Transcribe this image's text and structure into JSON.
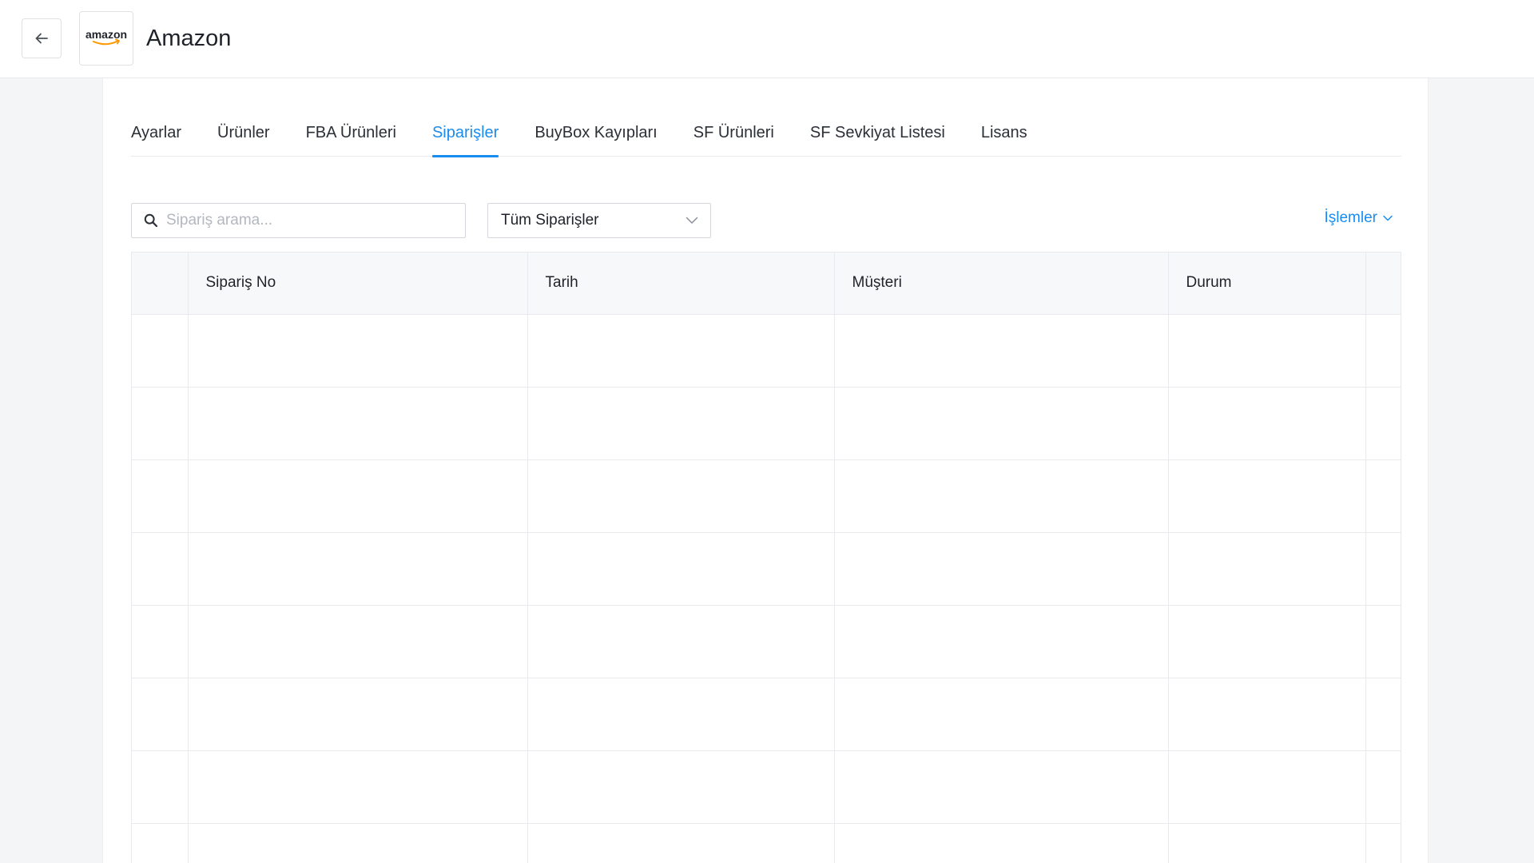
{
  "header": {
    "title": "Amazon",
    "logo_text": "amazon",
    "back_icon": "arrow-left-icon"
  },
  "tabs": [
    {
      "label": "Ayarlar",
      "active": false
    },
    {
      "label": "Ürünler",
      "active": false
    },
    {
      "label": "FBA Ürünleri",
      "active": false
    },
    {
      "label": "Siparişler",
      "active": true
    },
    {
      "label": "BuyBox Kayıpları",
      "active": false
    },
    {
      "label": "SF Ürünleri",
      "active": false
    },
    {
      "label": "SF Sevkiyat Listesi",
      "active": false
    },
    {
      "label": "Lisans",
      "active": false
    }
  ],
  "toolbar": {
    "search_placeholder": "Sipariş arama...",
    "search_value": "",
    "filter_value": "Tüm Siparişler",
    "actions_label": "İşlemler"
  },
  "table": {
    "columns": [
      "",
      "Sipariş No",
      "Tarih",
      "Müşteri",
      "Durum",
      ""
    ],
    "rows": 8
  },
  "colors": {
    "accent": "#1a8cf0",
    "logo_smile": "#ff9900"
  }
}
